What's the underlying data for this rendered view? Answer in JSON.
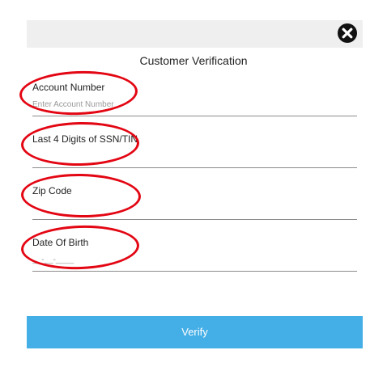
{
  "header": {
    "close_icon": "close-circle-icon"
  },
  "title": "Customer Verification",
  "fields": {
    "account_number": {
      "label": "Account Number",
      "placeholder": "Enter Account Number",
      "value": ""
    },
    "ssn_last4": {
      "label": "Last 4 Digits of SSN/TIN",
      "placeholder": "",
      "value": ""
    },
    "zip_code": {
      "label": "Zip Code",
      "placeholder": "",
      "value": ""
    },
    "date_of_birth": {
      "label": "Date Of Birth",
      "placeholder": "__-__-____",
      "value": ""
    }
  },
  "verify_button": {
    "label": "Verify"
  },
  "colors": {
    "accent": "#44aee6",
    "annotation": "#e30613",
    "header_bg": "#efefef"
  }
}
